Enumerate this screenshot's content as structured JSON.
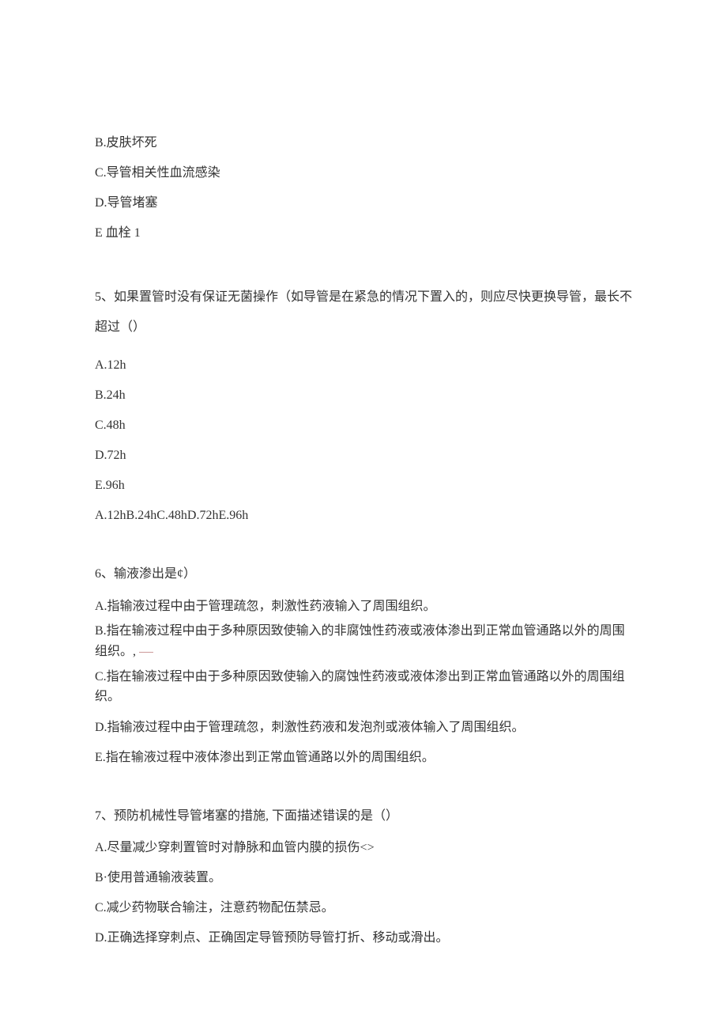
{
  "q4": {
    "options": {
      "b": "B.皮肤坏死",
      "c": "C.导管相关性血流感染",
      "d": "D.导管堵塞",
      "e": "E 血栓 1"
    }
  },
  "q5": {
    "stem": "5、如果置管时没有保证无菌操作（如导管是在紧急的情况下置入的，则应尽快更换导管，最长不超过（）",
    "options": {
      "a": "A.12h",
      "b": "B.24h",
      "c": "C.48h",
      "d": "D.72h",
      "e": "E.96h"
    },
    "combined": "A.12hB.24hC.48hD.72hE.96h"
  },
  "q6": {
    "stem": "6、输液渗出是¢）",
    "options": {
      "a": "A.指输液过程中由于管理疏忽，刺激性药液输入了周围组织。",
      "b": "B.指在输液过程中由于多种原因致使输入的非腐蚀性药液或液体渗出到正常血管通路以外的周围组织。,",
      "c": "C.指在输液过程中由于多种原因致使输入的腐蚀性药液或液体渗出到正常血管通路以外的周围组织。",
      "d": "D.指输液过程中由于管理疏忽，刺激性药液和发泡剂或液体输入了周围组织。",
      "e": "E.指在输液过程中液体渗出到正常血管通路以外的周围组织。"
    }
  },
  "q7": {
    "stem": "7、预防机械性导管堵塞的措施, 下面描述错误的是（）",
    "options": {
      "a": "A.尽量减少穿刺置管时对静脉和血管内膜的损伤<>",
      "b": "B·使用普通输液装置。",
      "c": "C.减少药物联合输注，注意药物配伍禁忌。",
      "d": "D.正确选择穿刺点、正确固定导管预防导管打折、移动或滑出。"
    }
  }
}
